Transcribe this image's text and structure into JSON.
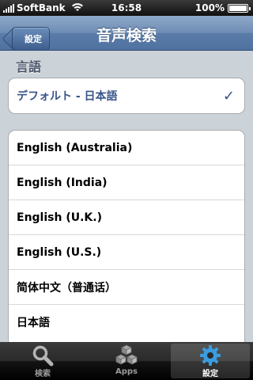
{
  "status_bar": {
    "carrier": "SoftBank",
    "time": "16:58",
    "battery": "100%"
  },
  "navbar": {
    "back_label": "設定",
    "title": "音声検索"
  },
  "language_section": {
    "header": "言語",
    "selected": "デフォルト - 日本語"
  },
  "languages": [
    "English (Australia)",
    "English (India)",
    "English (U.K.)",
    "English (U.S.)",
    "简体中文（普通话）",
    "日本語"
  ],
  "tabs": [
    {
      "label": "検索",
      "icon": "search-icon"
    },
    {
      "label": "Apps",
      "icon": "apps-cubes-icon"
    },
    {
      "label": "設定",
      "icon": "gear-icon"
    }
  ],
  "colors": {
    "accent": "#385487",
    "nav": "#5b7ca8",
    "background": "#cbd2d8"
  }
}
